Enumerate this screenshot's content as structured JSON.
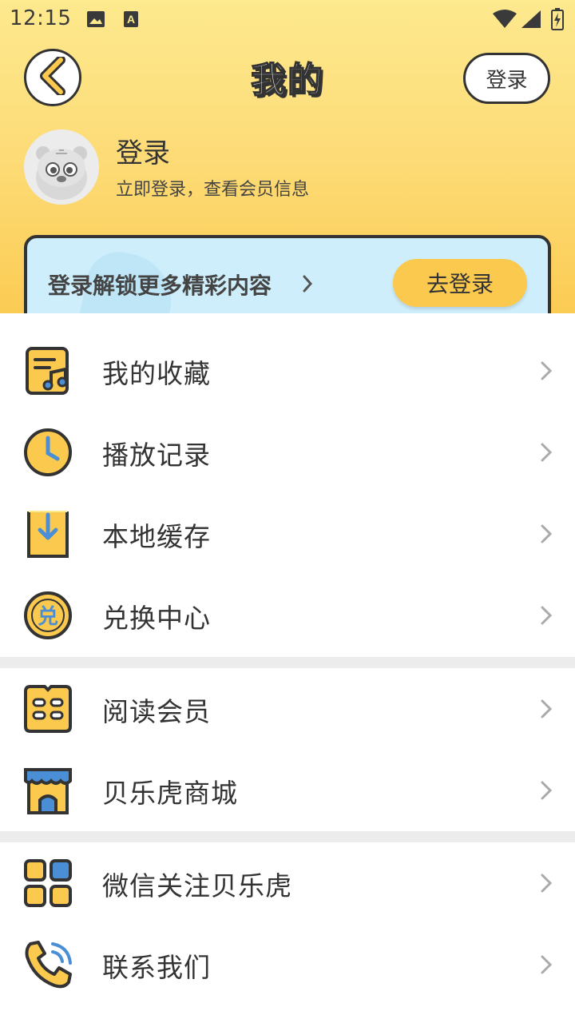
{
  "status_bar": {
    "time": "12:15",
    "icons": [
      "image-icon",
      "a-notification-icon",
      "wifi-icon",
      "signal-icon",
      "battery-icon"
    ]
  },
  "header": {
    "title": "我的",
    "login_button": "登录"
  },
  "profile": {
    "name": "登录",
    "subtitle": "立即登录，查看会员信息"
  },
  "banner": {
    "text": "登录解锁更多精彩内容",
    "button": "去登录"
  },
  "menu": {
    "favorites": "我的收藏",
    "history": "播放记录",
    "cache": "本地缓存",
    "redeem": "兑换中心",
    "reading": "阅读会员",
    "mall": "贝乐虎商城",
    "wechat": "微信关注贝乐虎",
    "contact": "联系我们",
    "redeem_icon_char": "兑"
  },
  "colors": {
    "accent_yellow": "#fbc94e",
    "icon_blue": "#4a8fd6",
    "outline": "#333333",
    "banner_bg": "#cfeefb"
  }
}
